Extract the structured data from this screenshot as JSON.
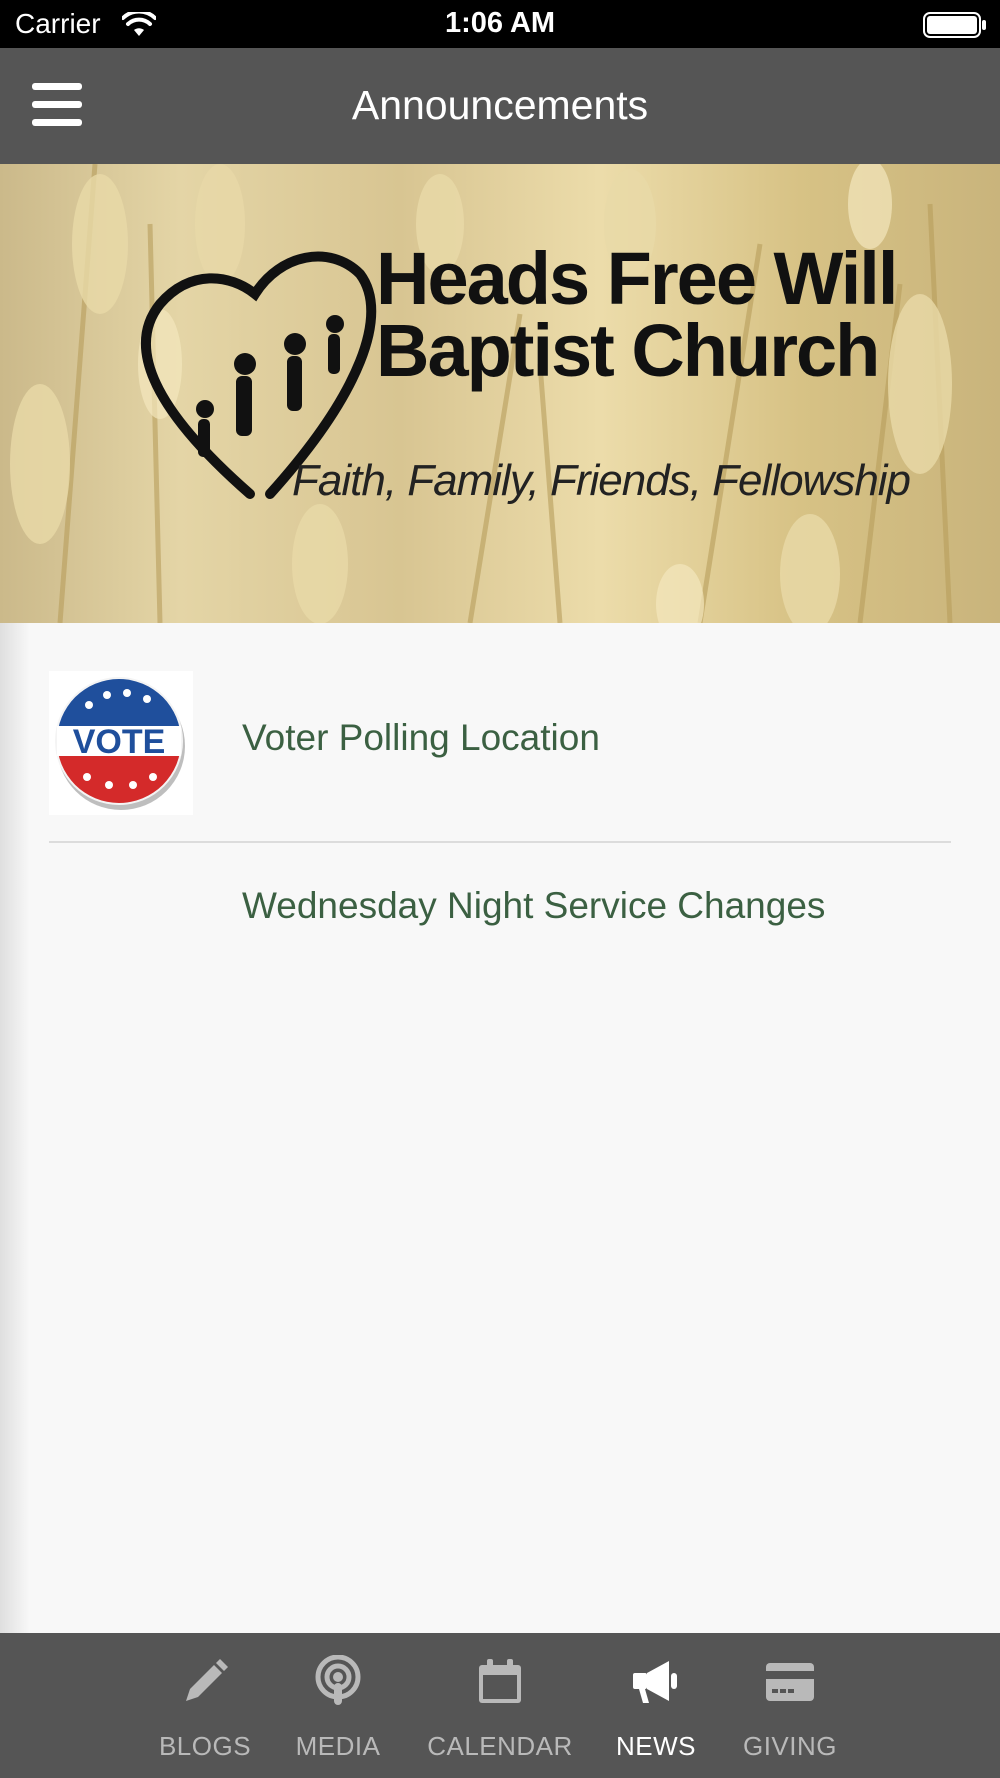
{
  "status_bar": {
    "carrier": "Carrier",
    "time": "1:06 AM"
  },
  "header": {
    "title": "Announcements"
  },
  "banner": {
    "church_name_line1": "Heads Free Will",
    "church_name_line2": "Baptist Church",
    "tagline": "Faith, Family, Friends, Fellowship"
  },
  "announcements": [
    {
      "title": "Voter Polling Location",
      "thumbnail": "VOTE"
    },
    {
      "title": "Wednesday Night Service Changes"
    }
  ],
  "tabs": [
    {
      "label": "BLOGS",
      "icon": "pencil-icon",
      "active": false
    },
    {
      "label": "MEDIA",
      "icon": "podcast-icon",
      "active": false
    },
    {
      "label": "CALENDAR",
      "icon": "calendar-icon",
      "active": false
    },
    {
      "label": "NEWS",
      "icon": "megaphone-icon",
      "active": true
    },
    {
      "label": "GIVING",
      "icon": "credit-card-icon",
      "active": false
    }
  ],
  "colors": {
    "nav_bar": "#555555",
    "link_text": "#3b6042",
    "tab_active": "#ffffff",
    "tab_inactive": "#b9b9b9"
  }
}
